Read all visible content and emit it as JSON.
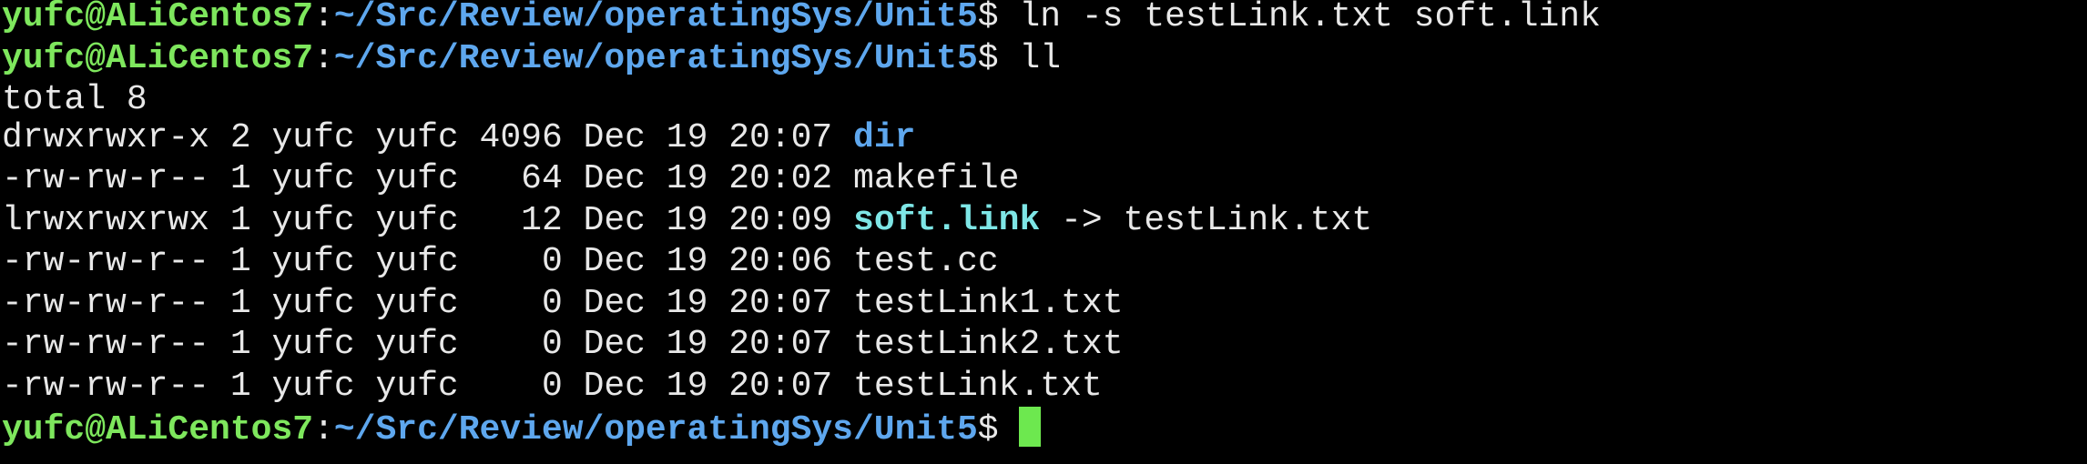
{
  "terminal": {
    "colors": {
      "background": "#000000",
      "text": "#e8e8e8",
      "user": "#7ee75d",
      "path": "#5ea7ee",
      "directory": "#5ea7ee",
      "symlink": "#7ee6e6",
      "cursor": "#6de84f"
    },
    "prompt": {
      "user_host": "yufc@ALiCentos7",
      "colon": ":",
      "path": "~/Src/Review/operatingSys/Unit5",
      "symbol": "$ "
    },
    "commands": [
      "ln -s testLink.txt soft.link",
      "ll"
    ],
    "total_line": "total 8",
    "listing": [
      {
        "perm": "drwxrwxr-x",
        "links": "2",
        "owner": "yufc",
        "group": "yufc",
        "size": "4096",
        "date": "Dec 19 20:07",
        "name": "dir",
        "type": "directory",
        "target": ""
      },
      {
        "perm": "-rw-rw-r--",
        "links": "1",
        "owner": "yufc",
        "group": "yufc",
        "size": "64",
        "date": "Dec 19 20:02",
        "name": "makefile",
        "type": "file",
        "target": ""
      },
      {
        "perm": "lrwxrwxrwx",
        "links": "1",
        "owner": "yufc",
        "group": "yufc",
        "size": "12",
        "date": "Dec 19 20:09",
        "name": "soft.link",
        "type": "symlink",
        "arrow": "->",
        "target": "testLink.txt"
      },
      {
        "perm": "-rw-rw-r--",
        "links": "1",
        "owner": "yufc",
        "group": "yufc",
        "size": "0",
        "date": "Dec 19 20:06",
        "name": "test.cc",
        "type": "file",
        "target": ""
      },
      {
        "perm": "-rw-rw-r--",
        "links": "1",
        "owner": "yufc",
        "group": "yufc",
        "size": "0",
        "date": "Dec 19 20:07",
        "name": "testLink1.txt",
        "type": "file",
        "target": ""
      },
      {
        "perm": "-rw-rw-r--",
        "links": "1",
        "owner": "yufc",
        "group": "yufc",
        "size": "0",
        "date": "Dec 19 20:07",
        "name": "testLink2.txt",
        "type": "file",
        "target": ""
      },
      {
        "perm": "-rw-rw-r--",
        "links": "1",
        "owner": "yufc",
        "group": "yufc",
        "size": "0",
        "date": "Dec 19 20:07",
        "name": "testLink.txt",
        "type": "file",
        "target": ""
      }
    ]
  }
}
